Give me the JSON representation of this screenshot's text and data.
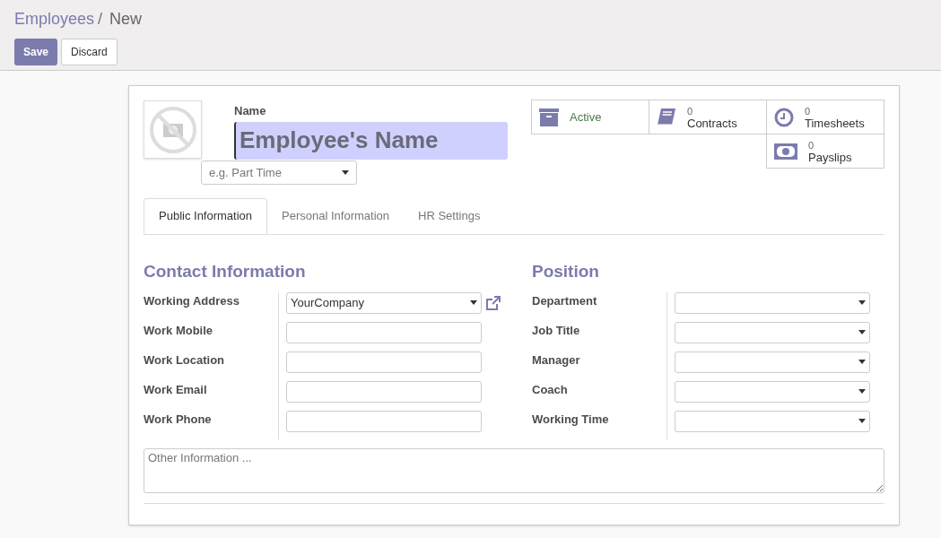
{
  "breadcrumb": [
    {
      "label": "Employees",
      "kind": "link"
    },
    {
      "label": "/",
      "kind": "separator"
    },
    {
      "label": "New",
      "kind": "current"
    }
  ],
  "buttons": [
    {
      "label": "Save",
      "kind": "primary"
    },
    {
      "label": "Discard",
      "kind": "secondary"
    }
  ],
  "stat_buttons": [
    {
      "kind": "archive",
      "label": "Active"
    },
    {
      "kind": "book",
      "value": "0",
      "label": "Contracts"
    },
    {
      "kind": "clock",
      "value": "0",
      "label": "Timesheets"
    },
    {
      "kind": "money",
      "value": "0",
      "label": "Payslips"
    }
  ],
  "name_field": {
    "label": "Name",
    "placeholder": "Employee's Name"
  },
  "job_field": {
    "placeholder": "e.g. Part Time"
  },
  "tabs": [
    {
      "label": "Public Information",
      "selected": true
    },
    {
      "label": "Personal Information",
      "selected": false
    },
    {
      "label": "HR Settings",
      "selected": false
    }
  ],
  "contact": {
    "title": "Contact Information",
    "fields": [
      {
        "label": "Working Address",
        "kind": "select",
        "value": "YourCompany",
        "link": true
      },
      {
        "label": "Work Mobile",
        "kind": "text"
      },
      {
        "label": "Work Location",
        "kind": "text"
      },
      {
        "label": "Work Email",
        "kind": "text"
      },
      {
        "label": "Work Phone",
        "kind": "text"
      }
    ]
  },
  "position": {
    "title": "Position",
    "fields": [
      {
        "label": "Department",
        "kind": "select"
      },
      {
        "label": "Job Title",
        "kind": "select"
      },
      {
        "label": "Manager",
        "kind": "select"
      },
      {
        "label": "Coach",
        "kind": "select"
      },
      {
        "label": "Working Time",
        "kind": "select"
      }
    ]
  },
  "notes": {
    "placeholder": "Other Information ..."
  }
}
